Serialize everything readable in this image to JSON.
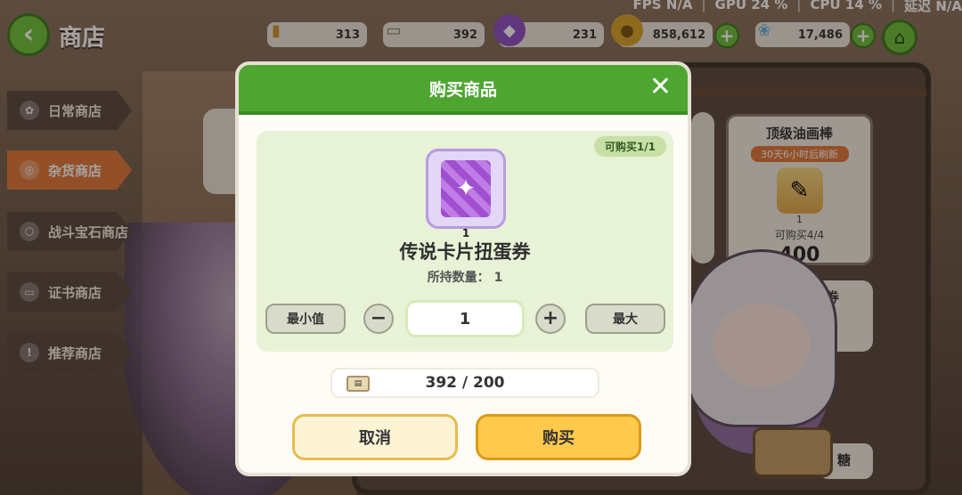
{
  "system": {
    "fps_label": "FPS",
    "fps_value": "N/A",
    "gpu_label": "GPU",
    "gpu_value": "24 %",
    "cpu_label": "CPU",
    "cpu_value": "14 %",
    "latency_label": "延迟",
    "latency_value": "N/A"
  },
  "header": {
    "title": "商店"
  },
  "resources": [
    {
      "icon": "bullet-icon",
      "value": "313"
    },
    {
      "icon": "certificate-icon",
      "value": "392"
    },
    {
      "icon": "purple-gem-icon",
      "value": "231"
    },
    {
      "icon": "gold-coin-icon",
      "value": "858,612"
    },
    {
      "icon": "crystal-flower-icon",
      "value": "17,486"
    }
  ],
  "sidebar": {
    "items": [
      {
        "label": "日常商店",
        "icon": "gear-flower-icon",
        "active": false
      },
      {
        "label": "杂货商店",
        "icon": "coins-icon",
        "active": true
      },
      {
        "label": "战斗宝石商店",
        "icon": "gem-icon",
        "active": false
      },
      {
        "label": "证书商店",
        "icon": "ticket-icon",
        "active": false
      },
      {
        "label": "推荐商店",
        "icon": "exclamation-icon",
        "active": false
      }
    ]
  },
  "shop_card": {
    "name": "顶级油画棒",
    "timer": "30天6小时后刷新",
    "qty": "1",
    "limit": "可购买4/4",
    "price": "400"
  },
  "shop_card2": {
    "name": "蛋券"
  },
  "shop_card3": {
    "name": "糖"
  },
  "modal": {
    "title": "购买商品",
    "limit": "可购买1/1",
    "item_name": "传说卡片扭蛋券",
    "item_count": "1",
    "owned_label": "所持数量：",
    "owned_value": "1",
    "min_label": "最小值",
    "max_label": "最大",
    "minus": "−",
    "plus": "+",
    "quantity": "1",
    "cost": "392 / 200",
    "cancel": "取消",
    "buy": "购买"
  },
  "colors": {
    "accent_green": "#4ea631",
    "active_tab": "#e07a3a",
    "buy_yellow": "#ffc94d"
  }
}
